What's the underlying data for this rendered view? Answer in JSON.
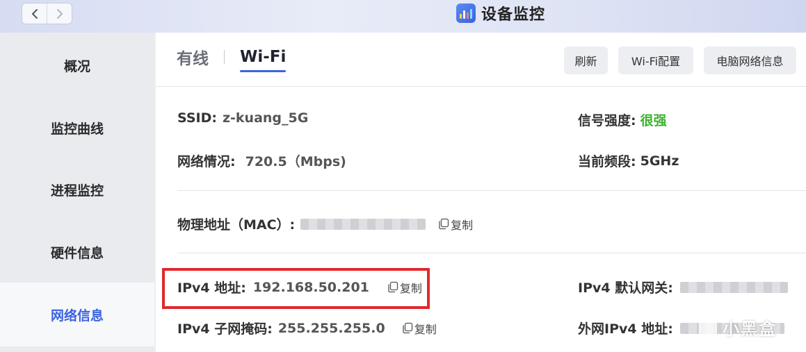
{
  "titlebar": {
    "title": "设备监控",
    "back_icon": "chevron-left-icon",
    "forward_icon": "chevron-right-icon",
    "app_icon": "bar-chart-icon"
  },
  "sidebar": {
    "items": [
      {
        "label": "概况",
        "active": false
      },
      {
        "label": "监控曲线",
        "active": false
      },
      {
        "label": "进程监控",
        "active": false
      },
      {
        "label": "硬件信息",
        "active": false
      },
      {
        "label": "网络信息",
        "active": true
      }
    ]
  },
  "tabs": [
    {
      "label": "有线",
      "active": false
    },
    {
      "label": "Wi-Fi",
      "active": true
    }
  ],
  "toolbar": {
    "refresh": "刷新",
    "wifi_config": "Wi-Fi配置",
    "pc_network_info": "电脑网络信息"
  },
  "wifi": {
    "ssid_label": "SSID:",
    "ssid_value": "z-kuang_5G",
    "signal_label": "信号强度:",
    "signal_value": "很强",
    "network_label": "网络情况:",
    "network_value": "720.5（Mbps)",
    "band_label": "当前频段:",
    "band_value": "5GHz",
    "mac_label": "物理地址（MAC）:",
    "ipv4_label": "IPv4 地址:",
    "ipv4_value": "192.168.50.201",
    "gateway_label": "IPv4 默认网关:",
    "subnet_label": "IPv4 子网掩码:",
    "subnet_value": "255.255.255.0",
    "public_ipv4_label": "外网IPv4 地址:",
    "copy_label": "复制"
  },
  "watermark": {
    "text": "小黑盒"
  },
  "colors": {
    "accent": "#3b63e5",
    "signal_strong": "#39b32c",
    "highlight_border": "#e2282d"
  }
}
